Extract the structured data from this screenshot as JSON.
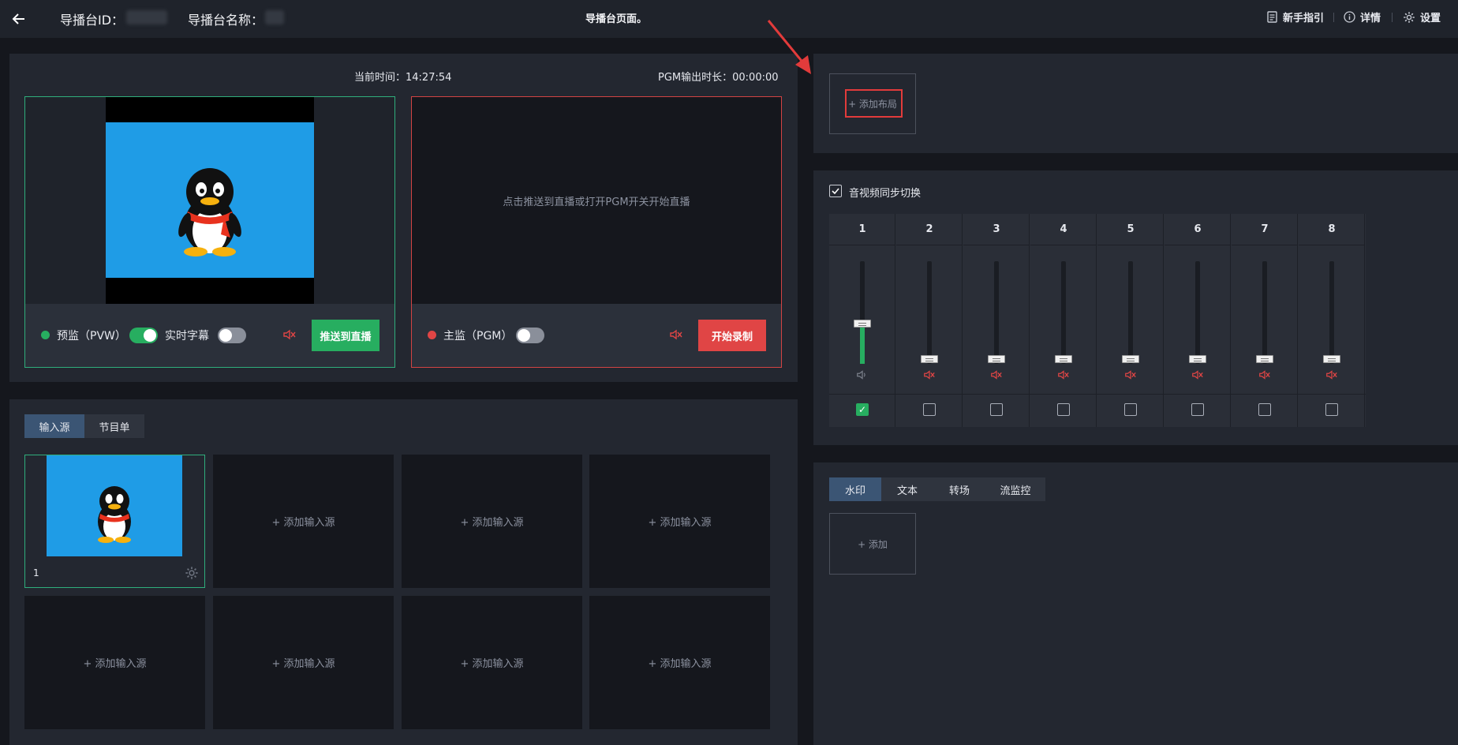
{
  "header": {
    "back_icon": "arrow-left-icon",
    "director_id_label": "导播台ID：",
    "director_name_label": "导播台名称：",
    "page_title": "导播台页面。",
    "guide_label": "新手指引",
    "details_label": "详情",
    "settings_label": "设置"
  },
  "monitor": {
    "current_time_label": "当前时间：14:27:54",
    "pgm_duration_label": "PGM输出时长：00:00:00",
    "pvw_label": "预监（PVW）",
    "subtitle_label": "实时字幕",
    "push_live_label": "推送到直播",
    "pgm_label": "主监（PGM）",
    "pgm_placeholder": "点击推送到直播或打开PGM开关开始直播",
    "start_record_label": "开始录制",
    "pvw_toggle_on": true,
    "subtitle_toggle_on": false,
    "pgm_toggle_on": false
  },
  "sources": {
    "tabs": [
      "输入源",
      "节目单"
    ],
    "active_tab": "输入源",
    "first_source_index": "1",
    "add_source_label": "+ 添加输入源"
  },
  "layout": {
    "add_layout_label": "+ 添加布局"
  },
  "audio": {
    "sync_label": "音视频同步切换",
    "sync_checked": true,
    "channels": [
      "1",
      "2",
      "3",
      "4",
      "5",
      "6",
      "7",
      "8"
    ],
    "channel_levels": [
      0.35,
      0.0,
      0.0,
      0.0,
      0.0,
      0.0,
      0.0,
      0.0
    ],
    "channel_muted": [
      false,
      true,
      true,
      true,
      true,
      true,
      true,
      true
    ],
    "channel_selected": [
      true,
      false,
      false,
      false,
      false,
      false,
      false,
      false
    ]
  },
  "effects": {
    "tabs": [
      "水印",
      "文本",
      "转场",
      "流监控"
    ],
    "active_tab": "水印",
    "add_label": "+ 添加"
  },
  "colors": {
    "accent_green": "#27ae60",
    "accent_red": "#e04545",
    "tab_active": "#3b5574",
    "preview_sky": "#1f9ce6"
  }
}
